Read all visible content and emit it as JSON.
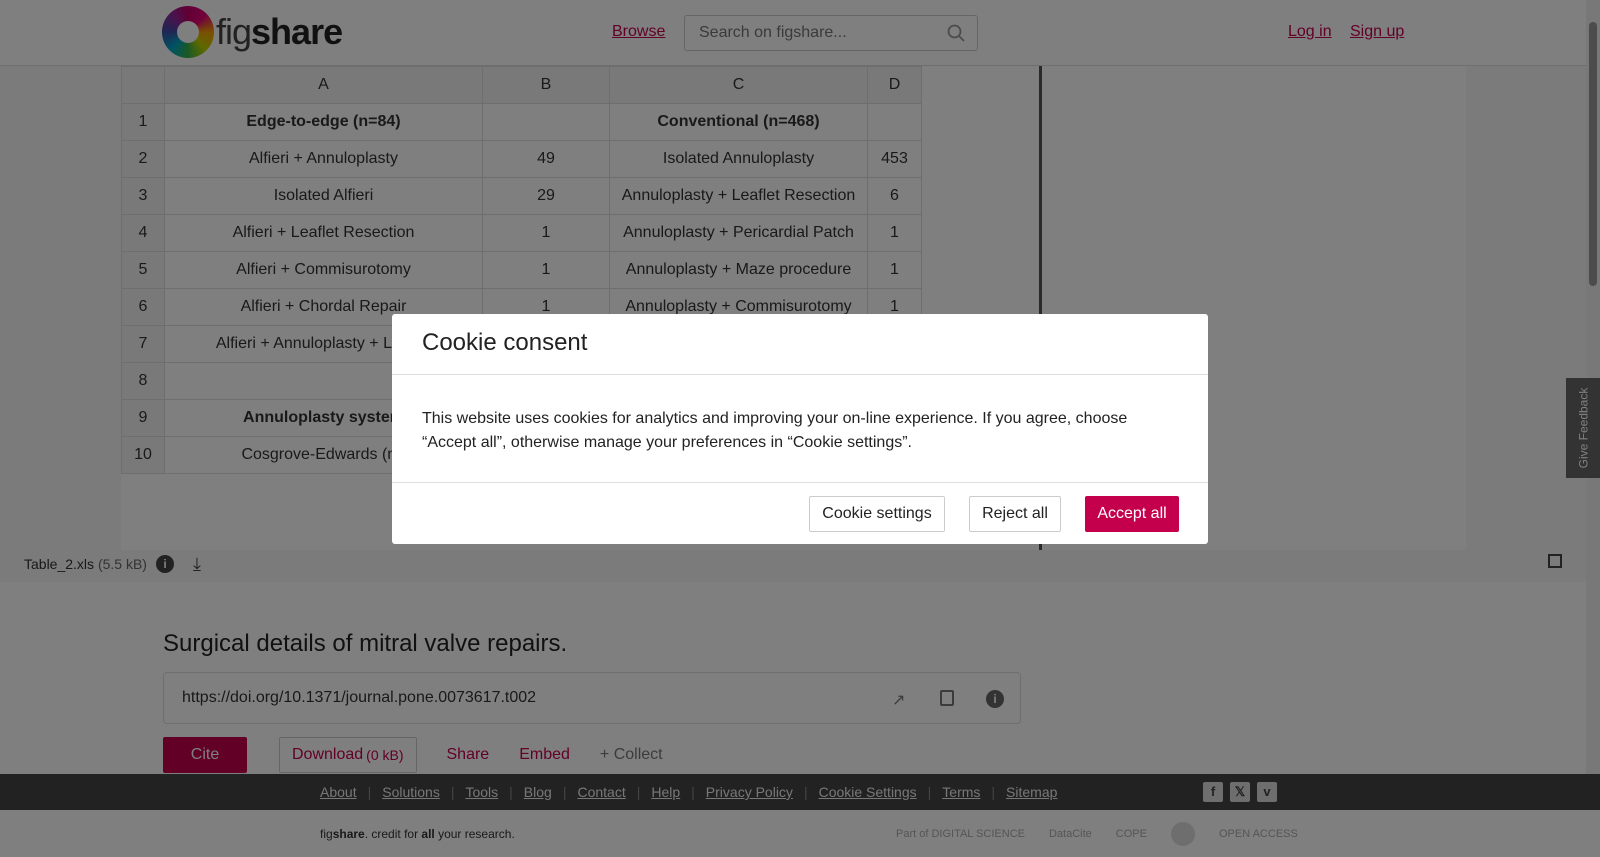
{
  "header": {
    "logo_prefix": "fig",
    "logo_suffix": "share",
    "browse_label": "Browse",
    "search_placeholder": "Search on figshare...",
    "login_label": "Log in",
    "signup_label": "Sign up"
  },
  "sheet": {
    "columns": [
      "A",
      "B",
      "C",
      "D"
    ],
    "rows": [
      {
        "n": "1",
        "a": "Edge-to-edge (n=84)",
        "b": "",
        "c": "Conventional (n=468)",
        "d": ""
      },
      {
        "n": "2",
        "a": "Alfieri + Annuloplasty",
        "b": "49",
        "c": "Isolated Annuloplasty",
        "d": "453"
      },
      {
        "n": "3",
        "a": "Isolated Alfieri",
        "b": "29",
        "c": "Annuloplasty + Leaflet Resection",
        "d": "6"
      },
      {
        "n": "4",
        "a": "Alfieri + Leaflet Resection",
        "b": "1",
        "c": "Annuloplasty + Pericardial Patch",
        "d": "1"
      },
      {
        "n": "5",
        "a": "Alfieri + Commisurotomy",
        "b": "1",
        "c": "Annuloplasty + Maze procedure",
        "d": "1"
      },
      {
        "n": "6",
        "a": "Alfieri + Chordal Repair",
        "b": "1",
        "c": "Annuloplasty + Commisurotomy",
        "d": "1"
      },
      {
        "n": "7",
        "a": "Alfieri + Annuloplasty + Leaflet",
        "b": "",
        "c": "",
        "d": ""
      },
      {
        "n": "8",
        "a": "",
        "b": "",
        "c": "",
        "d": ""
      },
      {
        "n": "9",
        "a": "Annuloplasty system",
        "b": "",
        "c": "",
        "d": ""
      },
      {
        "n": "10",
        "a": "Cosgrove-Edwards (n=",
        "b": "",
        "c": "",
        "d": ""
      }
    ]
  },
  "file": {
    "name": "Table_2.xls",
    "size": "(5.5 kB)"
  },
  "item": {
    "title": "Surgical details of mitral valve repairs.",
    "doi": "https://doi.org/10.1371/journal.pone.0073617.t002",
    "cite_label": "Cite",
    "download_label": "Download",
    "download_size": "(0 kB)",
    "share_label": "Share",
    "embed_label": "Embed",
    "collect_label": "+ Collect"
  },
  "footer": {
    "links": [
      "About",
      "Solutions",
      "Tools",
      "Blog",
      "Contact",
      "Help",
      "Privacy Policy",
      "Cookie Settings",
      "Terms",
      "Sitemap"
    ],
    "tagline_fig": "fig",
    "tagline_share": "share",
    "tagline_mid": ". credit for ",
    "tagline_all": "all",
    "tagline_end": " your research.",
    "partners": [
      "Part of DIGITAL SCIENCE",
      "DataCite",
      "COPE",
      "",
      "OPEN ACCESS"
    ]
  },
  "feedback_label": "Give Feedback",
  "cookie": {
    "title": "Cookie consent",
    "body": "This website uses cookies for analytics and improving your on-line experience. If you agree, choose “Accept all”, otherwise manage your preferences in “Cookie settings”.",
    "settings_label": "Cookie settings",
    "reject_label": "Reject all",
    "accept_label": "Accept all"
  },
  "colors": {
    "accent": "#c4004d",
    "footer_bg": "#444444",
    "overlay": "rgba(0,0,0,0.5)"
  }
}
